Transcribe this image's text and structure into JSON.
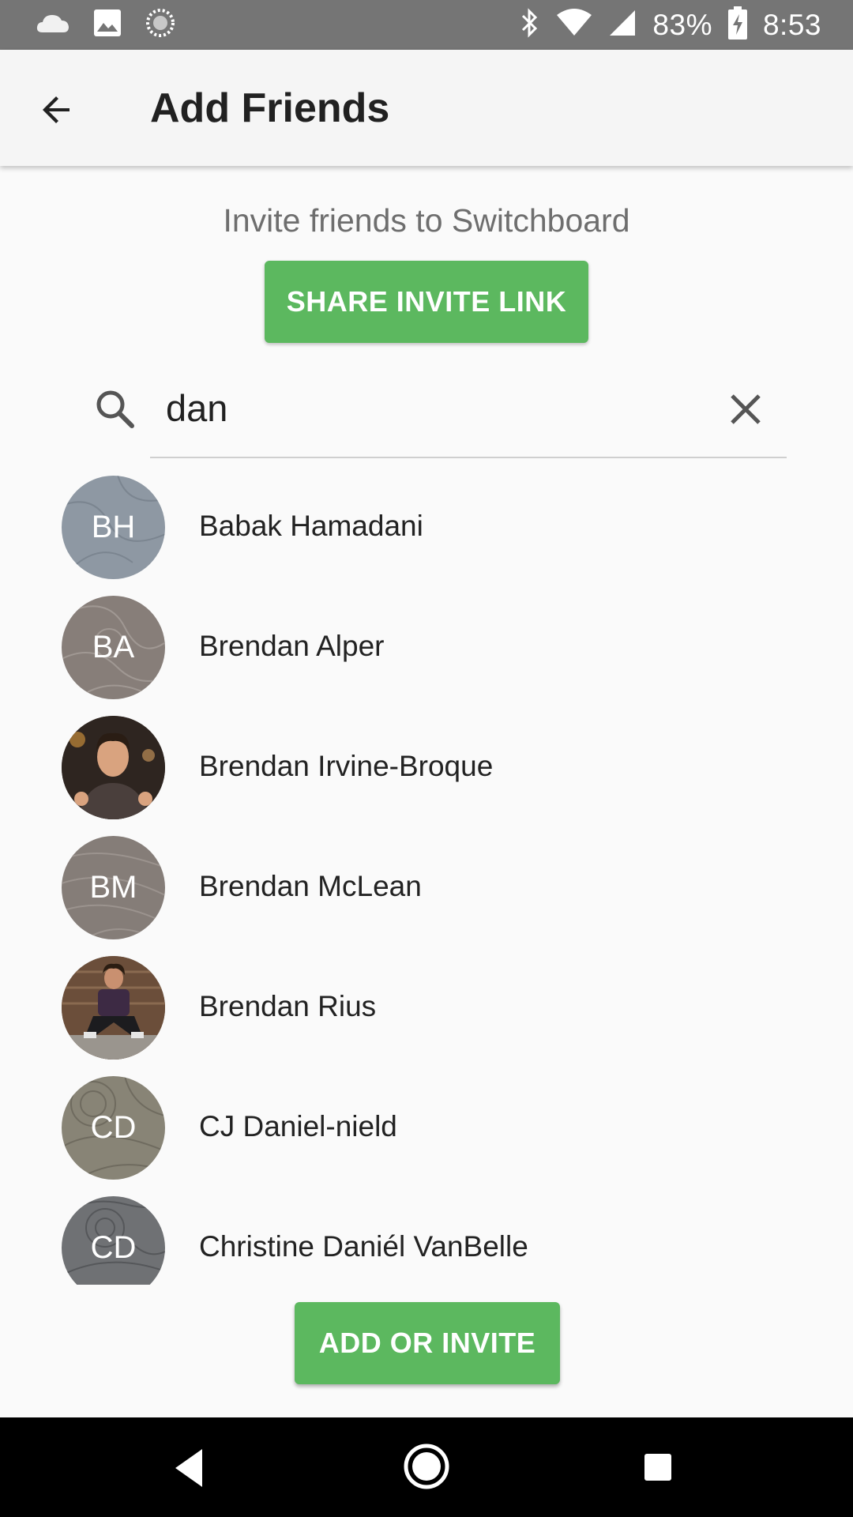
{
  "status_bar": {
    "battery": "83%",
    "time": "8:53",
    "icons": [
      "cloud-icon",
      "image-icon",
      "sync-icon",
      "bluetooth-icon",
      "wifi-icon",
      "signal-icon",
      "battery-charging-icon"
    ]
  },
  "app_bar": {
    "title": "Add Friends",
    "back_icon": "arrow-back-icon"
  },
  "invite": {
    "text": "Invite friends to Switchboard",
    "share_label": "SHARE INVITE LINK"
  },
  "search": {
    "value": "dan",
    "placeholder": ""
  },
  "contacts": [
    {
      "initials": "BH",
      "name": "Babak Hamadani",
      "avatar_color": "#8e98a3",
      "photo": false
    },
    {
      "initials": "BA",
      "name": "Brendan Alper",
      "avatar_color": "#877e79",
      "photo": false
    },
    {
      "initials": "",
      "name": "Brendan Irvine-Broque",
      "avatar_color": "#3b2e25",
      "photo": true
    },
    {
      "initials": "BM",
      "name": "Brendan McLean",
      "avatar_color": "#857d78",
      "photo": false
    },
    {
      "initials": "",
      "name": "Brendan Rius",
      "avatar_color": "#5a4334",
      "photo": true
    },
    {
      "initials": "CD",
      "name": "CJ Daniel-nield",
      "avatar_color": "#888476",
      "photo": false
    },
    {
      "initials": "CD",
      "name": "Christine Daniél VanBelle",
      "avatar_color": "#6f7174",
      "photo": false
    }
  ],
  "actions": {
    "add_label": "ADD OR INVITE"
  },
  "colors": {
    "accent": "#5cb85f",
    "status_bar": "#757575",
    "app_bar": "#f5f5f5"
  }
}
